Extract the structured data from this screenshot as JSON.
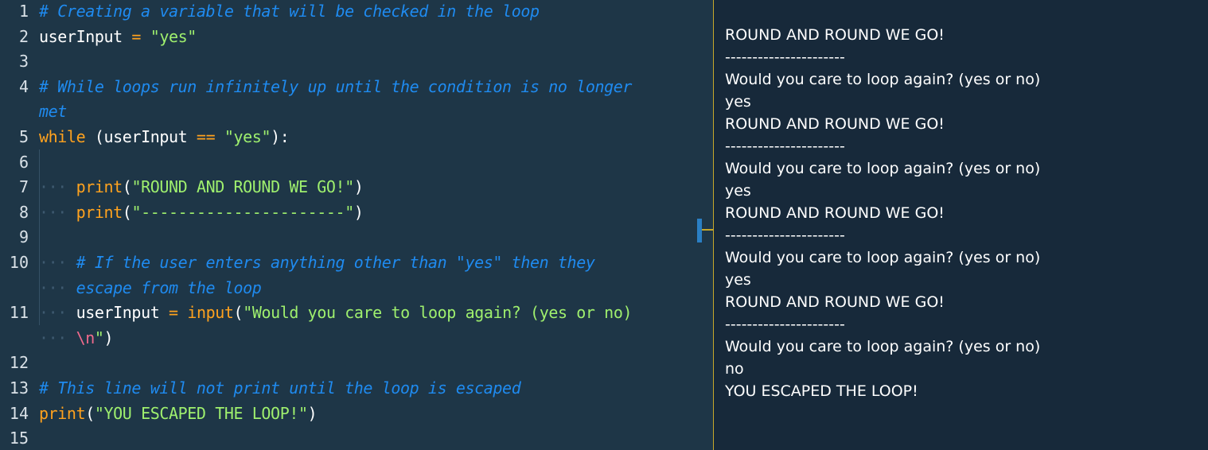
{
  "editor": {
    "lines": [
      {
        "num": "1",
        "tokens": [
          {
            "t": "comment",
            "v": "# Creating a variable that will be checked in the loop"
          }
        ]
      },
      {
        "num": "2",
        "tokens": [
          {
            "t": "plain",
            "v": "userInput "
          },
          {
            "t": "op",
            "v": "="
          },
          {
            "t": "plain",
            "v": " "
          },
          {
            "t": "string",
            "v": "\"yes\""
          }
        ]
      },
      {
        "num": "3",
        "tokens": []
      },
      {
        "num": "4",
        "tokens": [
          {
            "t": "comment",
            "v": "# While loops run infinitely up until the condition is no longer"
          }
        ],
        "wrap": [
          [
            {
              "t": "comment",
              "v": "met"
            }
          ]
        ]
      },
      {
        "num": "5",
        "tokens": [
          {
            "t": "kw",
            "v": "while"
          },
          {
            "t": "plain",
            "v": " (userInput "
          },
          {
            "t": "op",
            "v": "=="
          },
          {
            "t": "plain",
            "v": " "
          },
          {
            "t": "string",
            "v": "\"yes\""
          },
          {
            "t": "plain",
            "v": "):"
          }
        ]
      },
      {
        "num": "6",
        "tokens": []
      },
      {
        "num": "7",
        "tokens": [
          {
            "t": "indent",
            "v": "    "
          },
          {
            "t": "func",
            "v": "print"
          },
          {
            "t": "plain",
            "v": "("
          },
          {
            "t": "string",
            "v": "\"ROUND AND ROUND WE GO!\""
          },
          {
            "t": "plain",
            "v": ")"
          }
        ]
      },
      {
        "num": "8",
        "tokens": [
          {
            "t": "indent",
            "v": "    "
          },
          {
            "t": "func",
            "v": "print"
          },
          {
            "t": "plain",
            "v": "("
          },
          {
            "t": "string",
            "v": "\"----------------------\""
          },
          {
            "t": "plain",
            "v": ")"
          }
        ]
      },
      {
        "num": "9",
        "tokens": []
      },
      {
        "num": "10",
        "tokens": [
          {
            "t": "indent",
            "v": "    "
          },
          {
            "t": "comment",
            "v": "# If the user enters anything other than \"yes\" then they"
          }
        ],
        "wrap": [
          [
            {
              "t": "indent",
              "v": "    "
            },
            {
              "t": "comment",
              "v": "escape from the loop"
            }
          ]
        ]
      },
      {
        "num": "11",
        "tokens": [
          {
            "t": "indent",
            "v": "    "
          },
          {
            "t": "plain",
            "v": "userInput "
          },
          {
            "t": "op",
            "v": "="
          },
          {
            "t": "plain",
            "v": " "
          },
          {
            "t": "func",
            "v": "input"
          },
          {
            "t": "plain",
            "v": "("
          },
          {
            "t": "string",
            "v": "\"Would you care to loop again? (yes or no)"
          }
        ],
        "wrap": [
          [
            {
              "t": "indent",
              "v": "    "
            },
            {
              "t": "escape",
              "v": "\\n"
            },
            {
              "t": "string",
              "v": "\""
            },
            {
              "t": "plain",
              "v": ")"
            }
          ]
        ]
      },
      {
        "num": "12",
        "tokens": []
      },
      {
        "num": "13",
        "tokens": [
          {
            "t": "comment",
            "v": "# This line will not print until the loop is escaped"
          }
        ]
      },
      {
        "num": "14",
        "tokens": [
          {
            "t": "func",
            "v": "print"
          },
          {
            "t": "plain",
            "v": "("
          },
          {
            "t": "string",
            "v": "\"YOU ESCAPED THE LOOP!\""
          },
          {
            "t": "plain",
            "v": ")"
          }
        ]
      },
      {
        "num": "15",
        "tokens": []
      }
    ]
  },
  "console": {
    "lines": [
      "ROUND AND ROUND WE GO!",
      "----------------------",
      "Would you care to loop again? (yes or no)",
      "yes",
      "ROUND AND ROUND WE GO!",
      "----------------------",
      "Would you care to loop again? (yes or no)",
      "yes",
      "ROUND AND ROUND WE GO!",
      "----------------------",
      "Would you care to loop again? (yes or no)",
      "yes",
      "ROUND AND ROUND WE GO!",
      "----------------------",
      "Would you care to loop again? (yes or no)",
      "no",
      "YOU ESCAPED THE LOOP!"
    ]
  },
  "colors": {
    "editor_bg": "#1e3647",
    "console_bg": "#17293a",
    "comment": "#1f8bf0",
    "string": "#9ff06e",
    "keyword": "#ffa21e",
    "escape": "#f06a8c",
    "divider": "#c8a82a"
  }
}
